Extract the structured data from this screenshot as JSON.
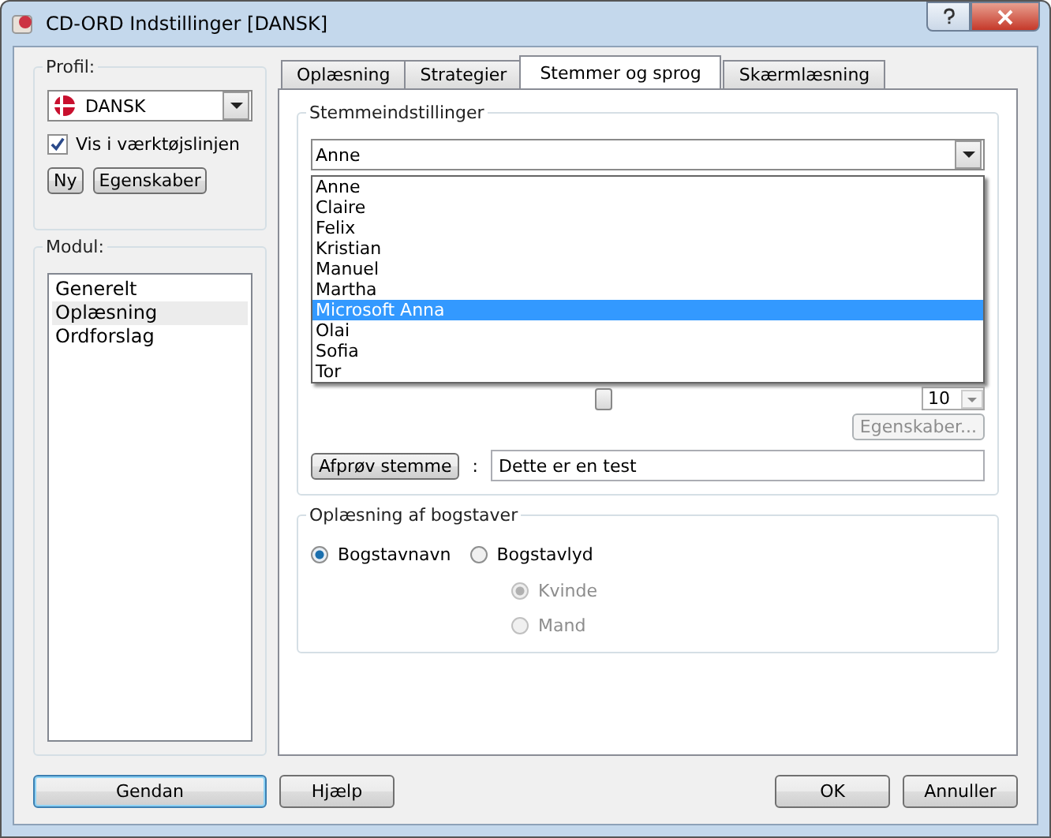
{
  "window": {
    "title": "CD-ORD Indstillinger [DANSK]"
  },
  "profile": {
    "label": "Profil:",
    "value": "DANSK",
    "show_in_toolbar": {
      "label": "Vis i værktøjslinjen",
      "checked": true
    },
    "buttons": [
      "Ny",
      "Egenskaber"
    ]
  },
  "module": {
    "label": "Modul:",
    "items": [
      {
        "label": "Generelt",
        "selected": false
      },
      {
        "label": "Oplæsning",
        "selected": true
      },
      {
        "label": "Ordforslag",
        "selected": false
      }
    ]
  },
  "tabs": [
    {
      "label": "Oplæsning",
      "selected": false
    },
    {
      "label": "Strategier",
      "selected": false
    },
    {
      "label": "Stemmer og sprog",
      "selected": true
    },
    {
      "label": "Skærmlæsning",
      "selected": false
    }
  ],
  "voice_settings": {
    "label": "Stemmeindstillinger",
    "voice": "Anne",
    "voice_list": [
      {
        "label": "Anne",
        "selected": false
      },
      {
        "label": "Claire",
        "selected": false
      },
      {
        "label": "Felix",
        "selected": false
      },
      {
        "label": "Kristian",
        "selected": false
      },
      {
        "label": "Manuel",
        "selected": false
      },
      {
        "label": "Martha",
        "selected": false
      },
      {
        "label": "Microsoft Anna",
        "selected": true
      },
      {
        "label": "Olai",
        "selected": false
      },
      {
        "label": "Sofia",
        "selected": false
      },
      {
        "label": "Tor",
        "selected": false
      }
    ],
    "speed": "10",
    "properties_button": {
      "label": "Egenskaber...",
      "disabled": true
    },
    "test_button": "Afprøv stemme",
    "separator": ":",
    "test_text": "Dette er en test"
  },
  "letters": {
    "label": "Oplæsning af bogstaver",
    "options": [
      {
        "label": "Bogstavnavn",
        "selected": true,
        "disabled": false
      },
      {
        "label": "Bogstavlyd",
        "selected": false,
        "disabled": false
      }
    ],
    "voice_options": [
      {
        "label": "Kvinde",
        "selected": true,
        "disabled": true
      },
      {
        "label": "Mand",
        "selected": false,
        "disabled": true
      }
    ]
  },
  "footer": [
    {
      "label": "Gendan",
      "kind": "default"
    },
    {
      "label": "Hjælp",
      "kind": "normal"
    },
    {
      "label": "OK",
      "kind": "normal"
    },
    {
      "label": "Annuller",
      "kind": "normal"
    }
  ]
}
